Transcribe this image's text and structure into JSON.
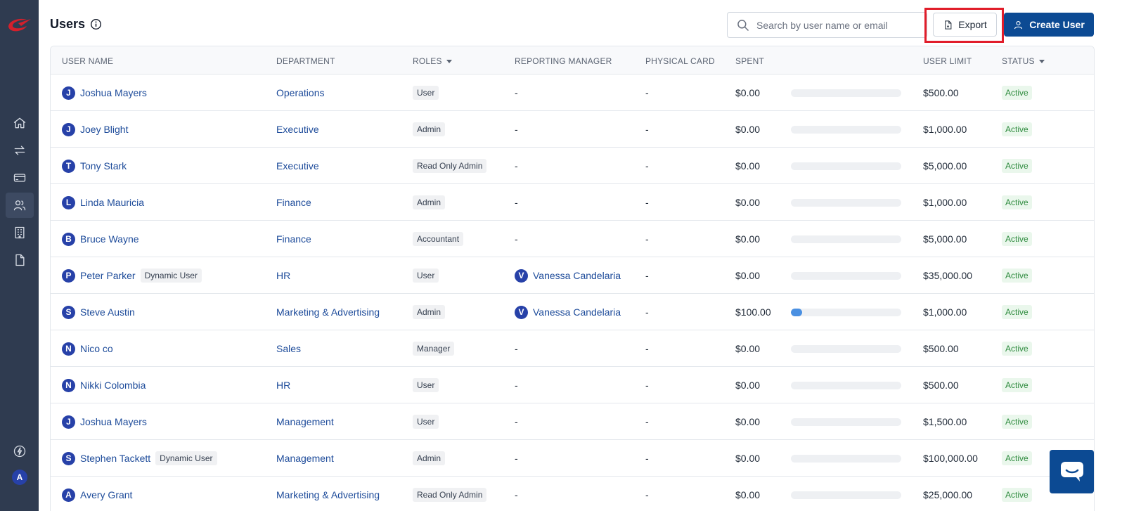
{
  "page": {
    "title": "Users"
  },
  "search": {
    "placeholder": "Search by user name or email"
  },
  "actions": {
    "export_label": "Export",
    "create_label": "Create User"
  },
  "sidebar": {
    "items": [
      {
        "icon": "home-icon",
        "active": false
      },
      {
        "icon": "transfer-icon",
        "active": false
      },
      {
        "icon": "card-icon",
        "active": false
      },
      {
        "icon": "users-icon",
        "active": true
      },
      {
        "icon": "building-icon",
        "active": false
      },
      {
        "icon": "document-icon",
        "active": false
      }
    ],
    "footer_icon": "lightning-icon",
    "avatar_initial": "A"
  },
  "table": {
    "headers": {
      "user_name": "USER NAME",
      "department": "DEPARTMENT",
      "roles": "ROLES",
      "reporting_manager": "REPORTING MANAGER",
      "physical_card": "PHYSICAL CARD",
      "spent": "SPENT",
      "user_limit": "USER LIMIT",
      "status": "STATUS"
    },
    "rows": [
      {
        "initial": "J",
        "name": "Joshua Mayers",
        "dynamic": "",
        "department": "Operations",
        "role": "User",
        "manager_initial": "",
        "manager": "-",
        "card": "-",
        "spent": "$0.00",
        "progress": 0,
        "limit": "$500.00",
        "status": "Active"
      },
      {
        "initial": "J",
        "name": "Joey Blight",
        "dynamic": "",
        "department": "Executive",
        "role": "Admin",
        "manager_initial": "",
        "manager": "-",
        "card": "-",
        "spent": "$0.00",
        "progress": 0,
        "limit": "$1,000.00",
        "status": "Active"
      },
      {
        "initial": "T",
        "name": "Tony Stark",
        "dynamic": "",
        "department": "Executive",
        "role": "Read Only Admin",
        "manager_initial": "",
        "manager": "-",
        "card": "-",
        "spent": "$0.00",
        "progress": 0,
        "limit": "$5,000.00",
        "status": "Active"
      },
      {
        "initial": "L",
        "name": "Linda Mauricia",
        "dynamic": "",
        "department": "Finance",
        "role": "Admin",
        "manager_initial": "",
        "manager": "-",
        "card": "-",
        "spent": "$0.00",
        "progress": 0,
        "limit": "$1,000.00",
        "status": "Active"
      },
      {
        "initial": "B",
        "name": "Bruce Wayne",
        "dynamic": "",
        "department": "Finance",
        "role": "Accountant",
        "manager_initial": "",
        "manager": "-",
        "card": "-",
        "spent": "$0.00",
        "progress": 0,
        "limit": "$5,000.00",
        "status": "Active"
      },
      {
        "initial": "P",
        "name": "Peter Parker",
        "dynamic": "Dynamic User",
        "department": "HR",
        "role": "User",
        "manager_initial": "V",
        "manager": "Vanessa Candelaria",
        "card": "-",
        "spent": "$0.00",
        "progress": 0,
        "limit": "$35,000.00",
        "status": "Active"
      },
      {
        "initial": "S",
        "name": "Steve Austin",
        "dynamic": "",
        "department": "Marketing & Advertising",
        "role": "Admin",
        "manager_initial": "V",
        "manager": "Vanessa Candelaria",
        "card": "-",
        "spent": "$100.00",
        "progress": 10,
        "limit": "$1,000.00",
        "status": "Active"
      },
      {
        "initial": "N",
        "name": "Nico co",
        "dynamic": "",
        "department": "Sales",
        "role": "Manager",
        "manager_initial": "",
        "manager": "-",
        "card": "-",
        "spent": "$0.00",
        "progress": 0,
        "limit": "$500.00",
        "status": "Active"
      },
      {
        "initial": "N",
        "name": "Nikki Colombia",
        "dynamic": "",
        "department": "HR",
        "role": "User",
        "manager_initial": "",
        "manager": "-",
        "card": "-",
        "spent": "$0.00",
        "progress": 0,
        "limit": "$500.00",
        "status": "Active"
      },
      {
        "initial": "J",
        "name": "Joshua Mayers",
        "dynamic": "",
        "department": "Management",
        "role": "User",
        "manager_initial": "",
        "manager": "-",
        "card": "-",
        "spent": "$0.00",
        "progress": 0,
        "limit": "$1,500.00",
        "status": "Active"
      },
      {
        "initial": "S",
        "name": "Stephen Tackett",
        "dynamic": "Dynamic User",
        "department": "Management",
        "role": "Admin",
        "manager_initial": "",
        "manager": "-",
        "card": "-",
        "spent": "$0.00",
        "progress": 0,
        "limit": "$100,000.00",
        "status": "Active"
      },
      {
        "initial": "A",
        "name": "Avery Grant",
        "dynamic": "",
        "department": "Marketing & Advertising",
        "role": "Read Only Admin",
        "manager_initial": "",
        "manager": "-",
        "card": "-",
        "spent": "$0.00",
        "progress": 0,
        "limit": "$25,000.00",
        "status": "Active"
      }
    ]
  },
  "colors": {
    "primary": "#0c4a93",
    "accent_red": "#e11d2a",
    "sidebar": "#2f3b50",
    "link": "#1d4b9a",
    "status_green": "#2e8b3e"
  }
}
